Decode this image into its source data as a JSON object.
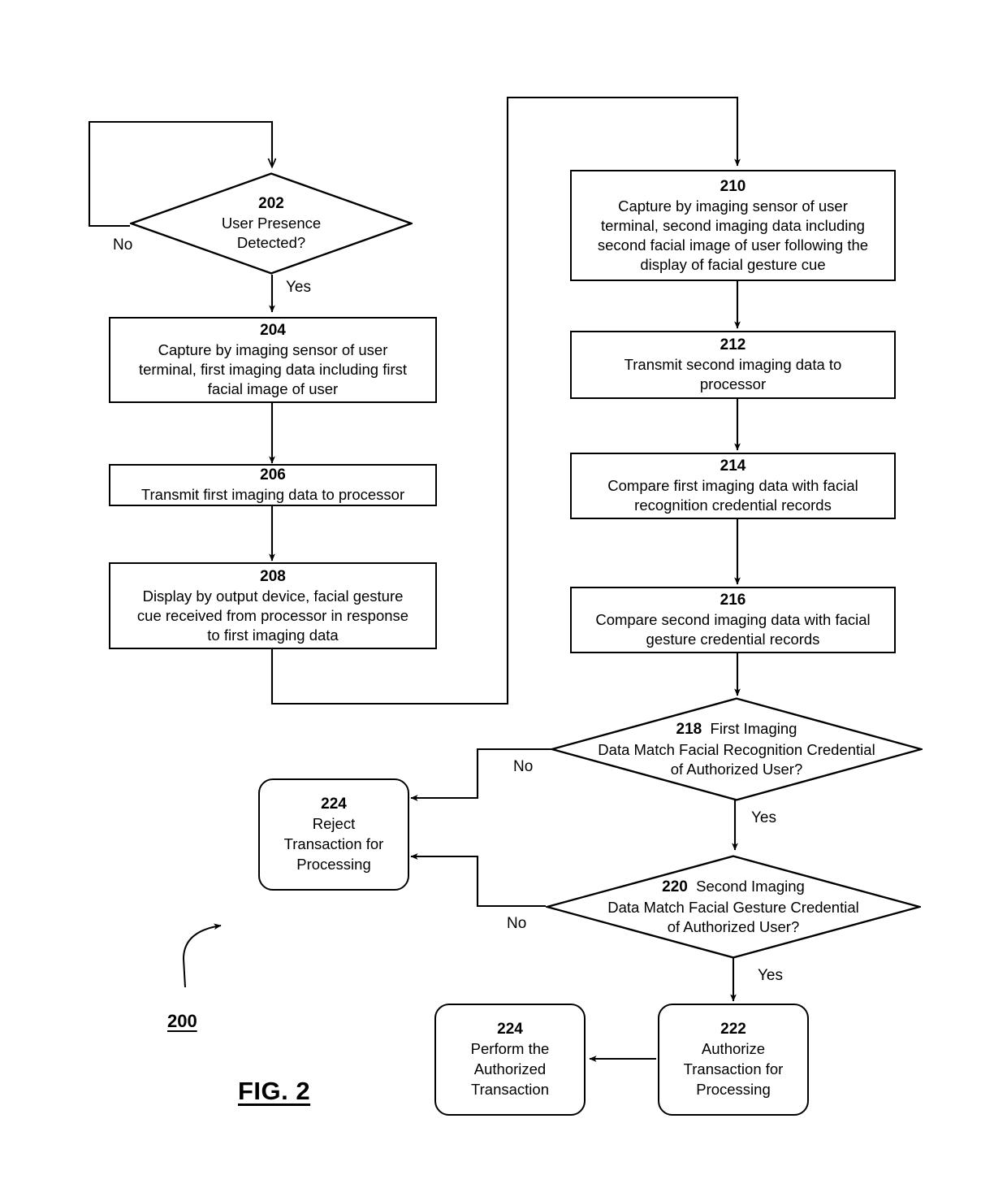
{
  "figure": {
    "caption": "FIG. 2",
    "diagram_number": "200"
  },
  "nodes": {
    "n202": {
      "ref": "202",
      "line1": "User Presence",
      "line2": "Detected?",
      "shape": "decision"
    },
    "n204": {
      "ref": "204",
      "line1": "Capture by imaging sensor of user",
      "line2": "terminal, first imaging data including first",
      "line3": "facial image of user",
      "shape": "process"
    },
    "n206": {
      "ref": "206",
      "line1": "Transmit first imaging data to processor",
      "shape": "process"
    },
    "n208": {
      "ref": "208",
      "line1": "Display by output device, facial gesture",
      "line2": "cue received from processor in response",
      "line3": "to first imaging data",
      "shape": "process"
    },
    "n210": {
      "ref": "210",
      "line1": "Capture by imaging sensor of user",
      "line2": "terminal, second imaging data including",
      "line3": "second facial image of user following the",
      "line4": "display of facial gesture cue",
      "shape": "process"
    },
    "n212": {
      "ref": "212",
      "line1": "Transmit second imaging data to",
      "line2": "processor",
      "shape": "process"
    },
    "n214": {
      "ref": "214",
      "line1": "Compare first imaging data with facial",
      "line2": "recognition credential records",
      "shape": "process"
    },
    "n216": {
      "ref": "216",
      "line1": "Compare second imaging data with facial",
      "line2": "gesture credential records",
      "shape": "process"
    },
    "n218": {
      "ref": "218",
      "line1": "First Imaging",
      "line2": "Data Match Facial Recognition Credential",
      "line3": "of Authorized User?",
      "shape": "decision"
    },
    "n220": {
      "ref": "220",
      "line1": "Second Imaging",
      "line2": "Data Match Facial Gesture Credential",
      "line3": "of Authorized User?",
      "shape": "decision"
    },
    "n222": {
      "ref": "222",
      "line1": "Authorize",
      "line2": "Transaction for",
      "line3": "Processing",
      "shape": "terminator"
    },
    "n224_reject": {
      "ref": "224",
      "line1": "Reject",
      "line2": "Transaction for",
      "line3": "Processing",
      "shape": "terminator"
    },
    "n224_perform": {
      "ref": "224",
      "line1": "Perform the",
      "line2": "Authorized",
      "line3": "Transaction",
      "shape": "terminator"
    }
  },
  "edge_labels": {
    "e202_no": "No",
    "e202_yes": "Yes",
    "e218_no": "No",
    "e218_yes": "Yes",
    "e220_no": "No",
    "e220_yes": "Yes"
  },
  "colors": {
    "stroke": "#000000",
    "background": "#ffffff",
    "text": "#000000"
  }
}
